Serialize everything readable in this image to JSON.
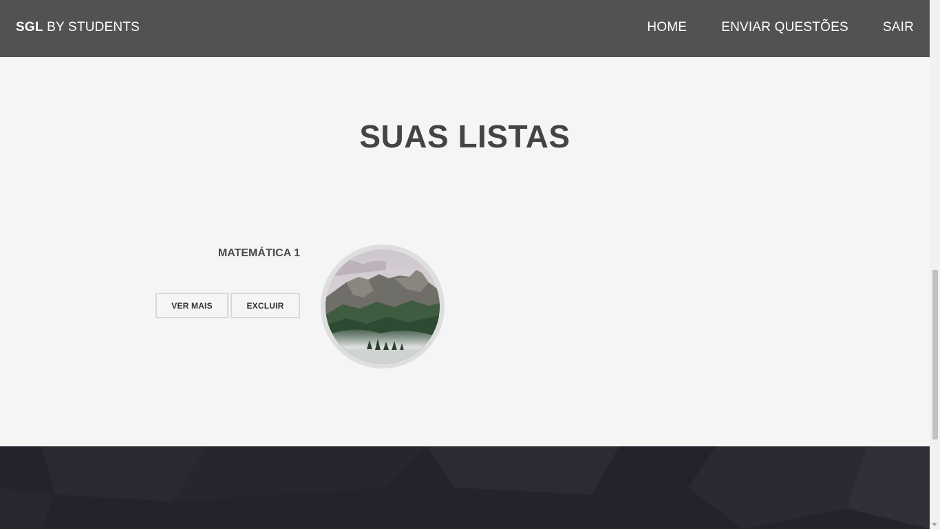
{
  "navbar": {
    "brand_bold": "SGL",
    "brand_rest": " BY STUDENTS",
    "links": [
      {
        "label": "HOME"
      },
      {
        "label": "ENVIAR QUESTÕES"
      },
      {
        "label": "SAIR"
      }
    ],
    "background": "#525252"
  },
  "main": {
    "title": "SUAS LISTAS",
    "lists": [
      {
        "title": "MATEMÁTICA 1",
        "view_label": "VER MAIS",
        "delete_label": "EXCLUIR",
        "image": "mountain-landscape"
      }
    ]
  },
  "footer": {
    "background": "#24222a"
  }
}
